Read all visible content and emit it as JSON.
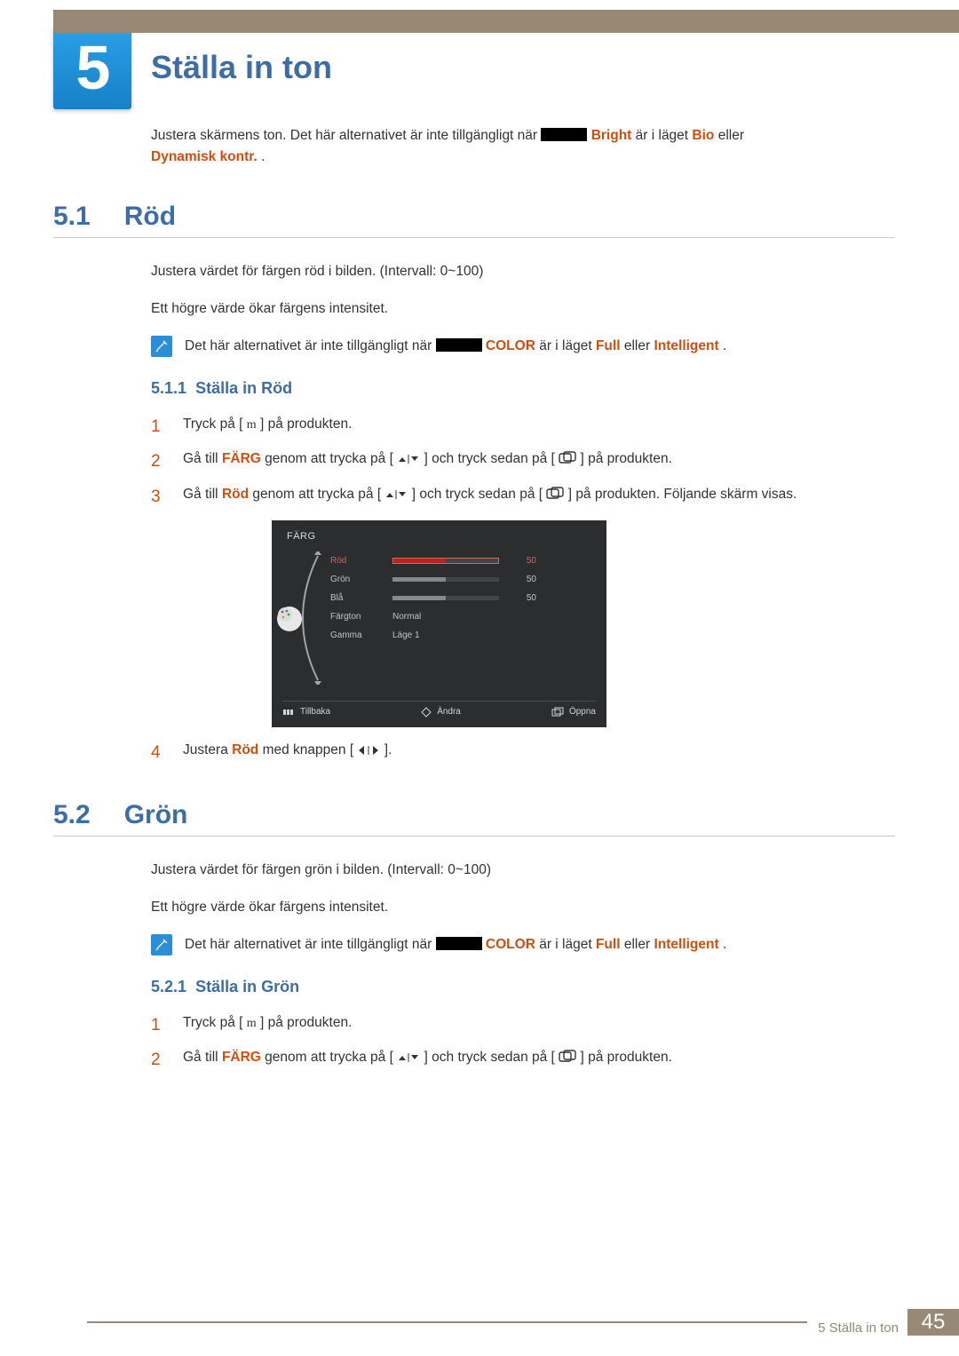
{
  "chapter": {
    "number": "5",
    "title": "Ställa in ton"
  },
  "intro": {
    "lead": "Justera skärmens ton. Det här alternativet är inte tillgängligt när ",
    "bright": "Bright",
    "mid": " är i läget ",
    "bio": "Bio",
    "or": " eller ",
    "dyn": "Dynamisk kontr.",
    "dot": "."
  },
  "s51": {
    "num": "5.1",
    "title": "Röd",
    "p1": "Justera värdet för färgen röd i bilden. (Intervall: 0~100)",
    "p2": "Ett högre värde ökar färgens intensitet.",
    "note": {
      "a": "Det här alternativet är inte tillgängligt när ",
      "color": "COLOR",
      "b": " är i läget ",
      "full": "Full",
      "c": " eller ",
      "intel": "Intelligent",
      "d": "."
    },
    "sub": {
      "num": "5.1.1",
      "title": "Ställa in Röd"
    },
    "steps": {
      "1": {
        "a": "Tryck på [ ",
        "b": " ] på produkten."
      },
      "2": {
        "a": "Gå till ",
        "farg": "FÄRG",
        "b": " genom att trycka på [",
        "c": "] och tryck sedan på [",
        "d": "] på produkten."
      },
      "3": {
        "a": "Gå till ",
        "rod": "Röd",
        "b": " genom att trycka på [",
        "c": "] och tryck sedan på [",
        "d": "] på produkten. Följande skärm visas."
      },
      "4": {
        "a": "Justera ",
        "rod": "Röd",
        "b": " med knappen [",
        "c": "]."
      }
    }
  },
  "osd": {
    "title": "FÄRG",
    "rows": {
      "rod": {
        "label": "Röd",
        "value": "50",
        "fill": 50
      },
      "gron": {
        "label": "Grön",
        "value": "50",
        "fill": 50
      },
      "bla": {
        "label": "Blå",
        "value": "50",
        "fill": 50
      },
      "fton": {
        "label": "Färgton",
        "text": "Normal"
      },
      "gamma": {
        "label": "Gamma",
        "text": "Läge 1"
      }
    },
    "foot": {
      "back": "Tillbaka",
      "chg": "Ändra",
      "open": "Öppna"
    }
  },
  "s52": {
    "num": "5.2",
    "title": "Grön",
    "p1": "Justera värdet för färgen grön i bilden. (Intervall: 0~100)",
    "p2": "Ett högre värde ökar färgens intensitet.",
    "note": {
      "a": "Det här alternativet är inte tillgängligt när ",
      "color": "COLOR",
      "b": " är i läget ",
      "full": "Full",
      "c": " eller ",
      "intel": "Intelligent",
      "d": "."
    },
    "sub": {
      "num": "5.2.1",
      "title": "Ställa in Grön"
    },
    "steps": {
      "1": {
        "a": "Tryck på [ ",
        "b": " ] på produkten."
      },
      "2": {
        "a": "Gå till ",
        "farg": "FÄRG",
        "b": " genom att trycka på [",
        "c": "] och tryck sedan på [",
        "d": "] på produkten."
      }
    }
  },
  "footer": {
    "text": "5 Ställa in ton",
    "page": "45"
  }
}
